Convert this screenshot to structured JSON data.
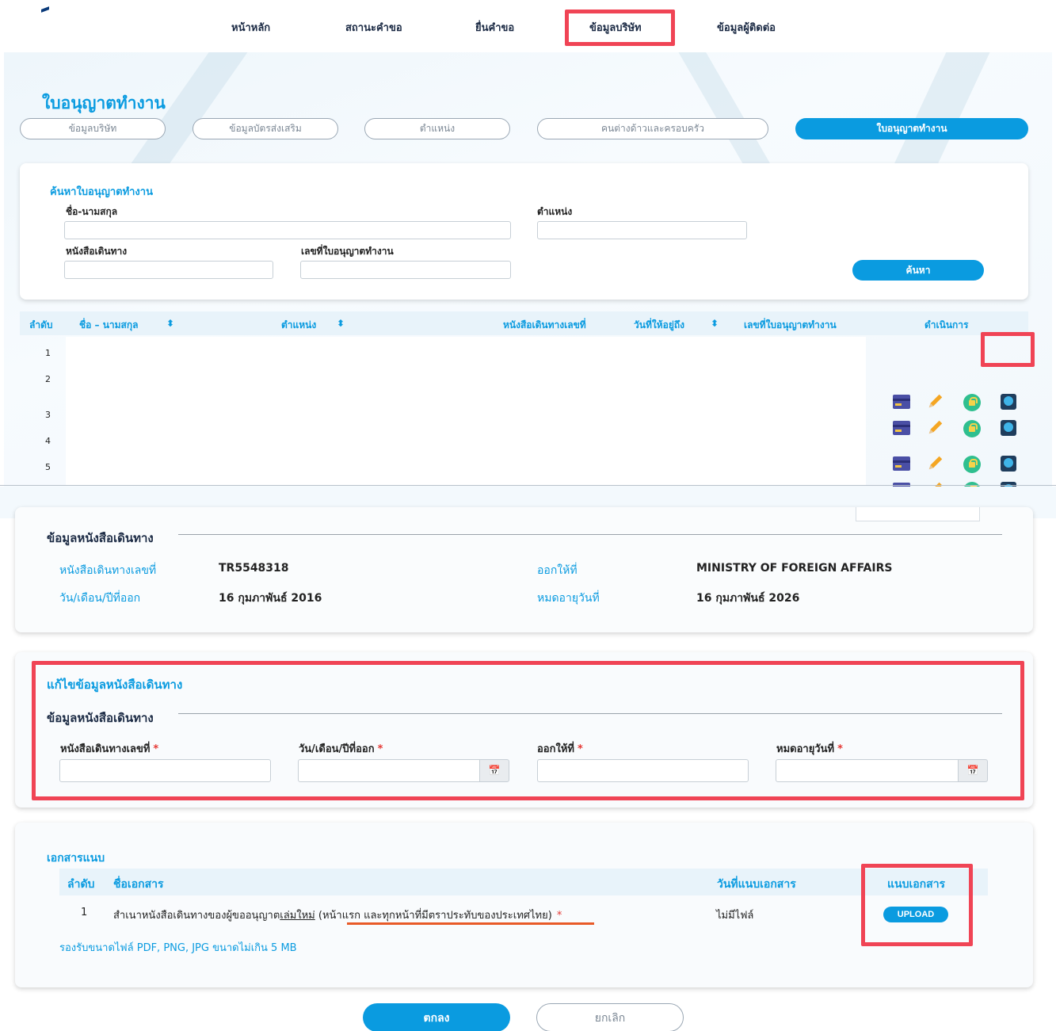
{
  "nav": {
    "items": [
      {
        "label": "หน้าหลัก"
      },
      {
        "label": "สถานะคำขอ"
      },
      {
        "label": "ยื่นคำขอ"
      },
      {
        "label": "ข้อมูลบริษัท"
      },
      {
        "label": "ข้อมูลผู้ติดต่อ"
      }
    ]
  },
  "page": {
    "title": "ใบอนุญาตทำงาน"
  },
  "subtabs": [
    {
      "label": "ข้อมูลบริษัท"
    },
    {
      "label": "ข้อมูลบัตรส่งเสริม"
    },
    {
      "label": "ตำแหน่ง"
    },
    {
      "label": "คนต่างด้าวและครอบครัว"
    },
    {
      "label": "ใบอนุญาตทำงาน"
    }
  ],
  "search": {
    "title": "ค้นหาใบอนุญาตทำงาน",
    "name_label": "ชื่อ-นามสกุล",
    "position_label": "ตำแหน่ง",
    "passport_label": "หนังสือเดินทาง",
    "permit_no_label": "เลขที่ใบอนุญาตทำงาน",
    "button": "ค้นหา"
  },
  "results": {
    "headers": {
      "no": "ลำดับ",
      "name": "ชื่อ – นามสกุล",
      "position": "ตำแหน่ง",
      "passport_no": "หนังสือเดินทางเลขที่",
      "valid_until": "วันที่ให้อยู่ถึง",
      "permit_no": "เลขที่ใบอนุญาตทำงาน",
      "actions": "ดำเนินการ"
    },
    "sort_icon": "⬍",
    "rows": [
      {
        "no": "1"
      },
      {
        "no": "2"
      },
      {
        "no": "3"
      },
      {
        "no": "4"
      },
      {
        "no": "5"
      }
    ]
  },
  "passport_info": {
    "section_title": "ข้อมูลหนังสือเดินทาง",
    "passport_no_label": "หนังสือเดินทางเลขที่",
    "passport_no": "TR5548318",
    "issued_by_label": "ออกให้ที่",
    "issued_by": "MINISTRY OF FOREIGN AFFAIRS",
    "issue_date_label": "วัน/เดือน/ปีที่ออก",
    "issue_date": "16 กุมภาพันธ์ 2016",
    "expiry_label": "หมดอายุวันที่",
    "expiry_date": "16 กุมภาพันธ์ 2026"
  },
  "edit_passport": {
    "title": "แก้ไขข้อมูลหนังสือเดินทาง",
    "section_title": "ข้อมูลหนังสือเดินทาง",
    "passport_no_label": "หนังสือเดินทางเลขที่",
    "issue_date_label": "วัน/เดือน/ปีที่ออก",
    "issued_by_label": "ออกให้ที่",
    "expiry_label": "หมดอายุวันที่",
    "required_mark": "*",
    "calendar_icon": "📅"
  },
  "attachments": {
    "title": "เอกสารแนบ",
    "headers": {
      "no": "ลำดับ",
      "doc_name": "ชื่อเอกสาร",
      "attached_date": "วันที่แนบเอกสาร",
      "attach": "แนบเอกสาร"
    },
    "row": {
      "no": "1",
      "doc_prefix": "สำเนาหนังสือเดินทางของผู้ขออนุญาต",
      "doc_underlined": "เล่มใหม่",
      "doc_suffix": " (หน้าแรก และทุกหน้าที่มีตราประทับของประเทศไทย)",
      "required_mark": "*",
      "attached_date": "ไม่มีไฟล์",
      "upload": "UPLOAD"
    },
    "note": "รองรับขนาดไฟล์ PDF, PNG, JPG ขนาดไม่เกิน 5 MB"
  },
  "footer": {
    "ok": "ตกลง",
    "cancel": "ยกเลิก"
  },
  "colors": {
    "accent": "#0a9be0",
    "highlight": "#f04455",
    "underline": "#e85a28"
  }
}
